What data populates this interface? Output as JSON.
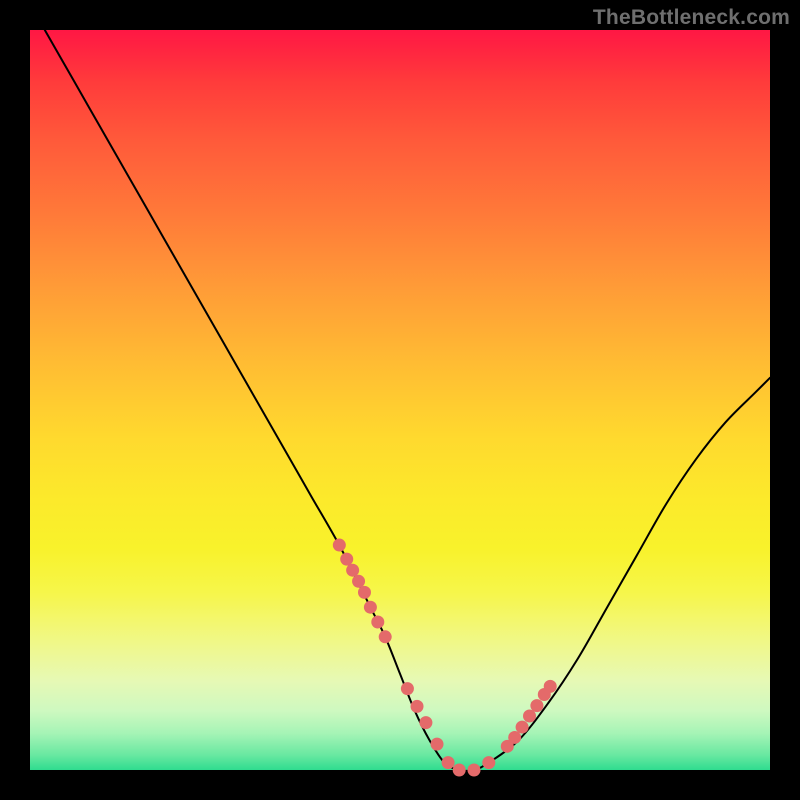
{
  "watermark": "TheBottleneck.com",
  "colors": {
    "page_bg": "#000000",
    "curve": "#000000",
    "dots": "#e46a6a",
    "gradient_top": "#ff1744",
    "gradient_bottom": "#2fdc8f"
  },
  "chart_data": {
    "type": "line",
    "title": "",
    "xlabel": "",
    "ylabel": "",
    "xlim": [
      0,
      100
    ],
    "ylim": [
      0,
      100
    ],
    "grid": false,
    "legend": false,
    "annotations": [],
    "series": [
      {
        "name": "bottleneck-curve",
        "x": [
          2,
          6,
          10,
          14,
          18,
          22,
          26,
          30,
          34,
          38,
          42,
          46,
          48,
          50,
          52,
          54,
          56,
          58,
          60,
          62,
          66,
          70,
          74,
          78,
          82,
          86,
          90,
          94,
          98,
          100
        ],
        "y": [
          100,
          93,
          86,
          79,
          72,
          65,
          58,
          51,
          44,
          37,
          30,
          22,
          18,
          13,
          8,
          4,
          1,
          0,
          0,
          1,
          4,
          9,
          15,
          22,
          29,
          36,
          42,
          47,
          51,
          53
        ]
      }
    ],
    "highlight_dots": {
      "name": "highlight-band",
      "x": [
        41.8,
        42.8,
        43.6,
        44.4,
        45.2,
        46.0,
        47.0,
        48.0,
        51.0,
        52.3,
        53.5,
        55.0,
        56.5,
        58.0,
        60.0,
        62.0,
        64.5,
        65.5,
        66.5,
        67.5,
        68.5,
        69.5,
        70.3
      ],
      "y": [
        30.4,
        28.5,
        27.0,
        25.5,
        24.0,
        22.0,
        20.0,
        18.0,
        11.0,
        8.6,
        6.4,
        3.5,
        1.0,
        0.0,
        0.0,
        1.0,
        3.2,
        4.4,
        5.8,
        7.3,
        8.7,
        10.2,
        11.3
      ]
    }
  }
}
